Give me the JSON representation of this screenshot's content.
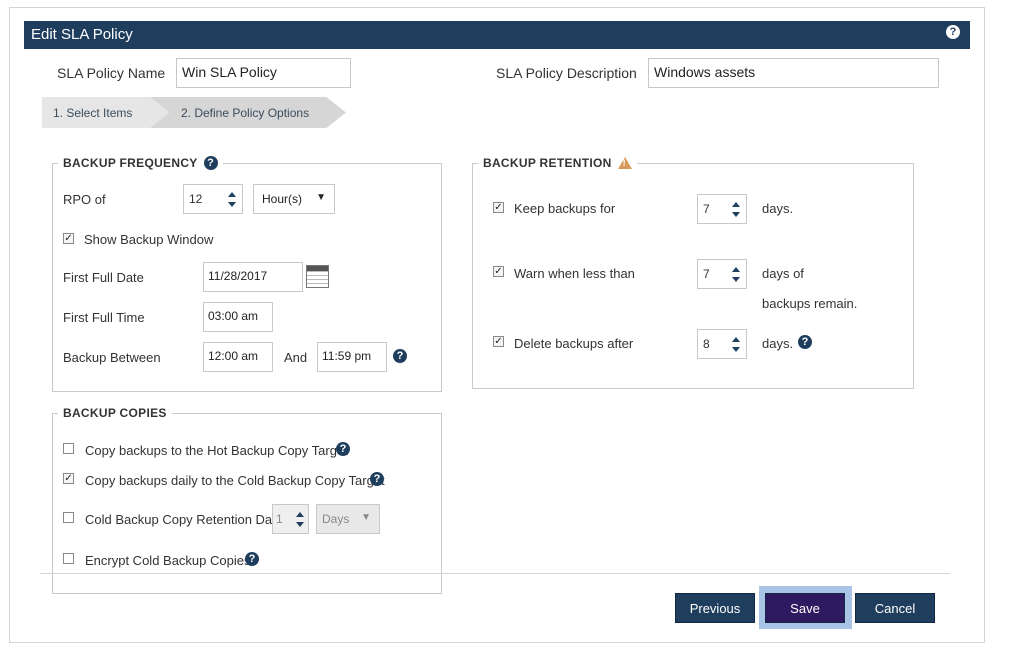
{
  "dialog": {
    "title": "Edit SLA Policy",
    "help_icon": "?"
  },
  "header": {
    "policy_name_label": "SLA Policy Name",
    "policy_name_value": "Win SLA Policy",
    "policy_desc_label": "SLA Policy Description",
    "policy_desc_value": "Windows assets"
  },
  "wizard": {
    "steps": [
      {
        "label": "1. Select Items"
      },
      {
        "label": "2. Define Policy Options"
      }
    ]
  },
  "backup_frequency": {
    "legend": "BACKUP FREQUENCY",
    "rpo_label": "RPO of",
    "rpo_value": "12",
    "rpo_unit": "Hour(s)",
    "show_window_label": "Show Backup Window",
    "show_window_checked": true,
    "first_full_date_label": "First Full Date",
    "first_full_date_value": "11/28/2017",
    "first_full_time_label": "First Full Time",
    "first_full_time_value": "03:00 am",
    "backup_between_label": "Backup Between",
    "between_start": "12:00 am",
    "and_label": "And",
    "between_end": "11:59 pm"
  },
  "backup_copies": {
    "legend": "BACKUP COPIES",
    "hot_copy_label": "Copy backups to the Hot Backup Copy Target",
    "hot_copy_checked": false,
    "cold_copy_label": "Copy backups daily to the Cold Backup Copy Target",
    "cold_copy_checked": true,
    "cold_retention_label": "Cold Backup Copy Retention Days",
    "cold_retention_checked": false,
    "cold_retention_value": "1",
    "cold_retention_unit": "Days",
    "encrypt_label": "Encrypt Cold Backup Copies",
    "encrypt_checked": false
  },
  "backup_retention": {
    "legend": "BACKUP RETENTION",
    "keep_label": "Keep backups for",
    "keep_value": "7",
    "keep_unit": "days.",
    "warn_label": "Warn when less than",
    "warn_value": "7",
    "warn_unit_line1": "days of",
    "warn_unit_line2": "backups remain.",
    "delete_label": "Delete backups after",
    "delete_value": "8",
    "delete_unit": "days."
  },
  "footer": {
    "previous_label": "Previous",
    "save_label": "Save",
    "cancel_label": "Cancel"
  },
  "colors": {
    "header_bg": "#1f3e5e",
    "save_bg": "#2d1a60",
    "warning": "#d89a5c"
  }
}
